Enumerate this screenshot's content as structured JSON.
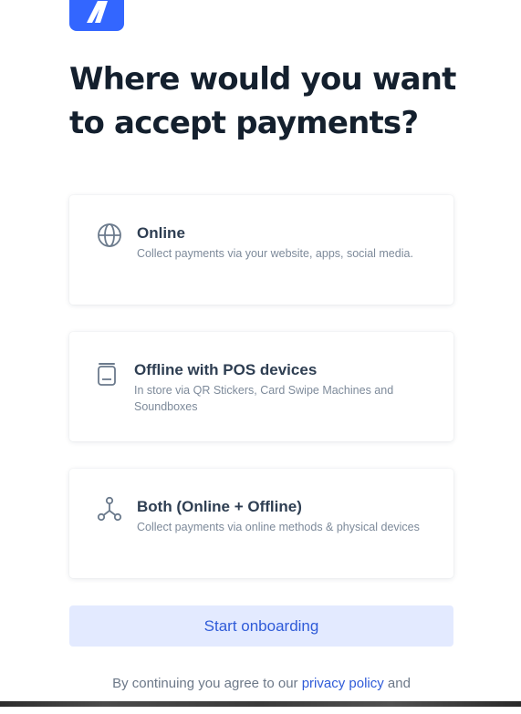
{
  "brand": {
    "logo_icon": "razorpay-logo-icon",
    "accent_color": "#3366ff"
  },
  "heading": {
    "title": "Where would you want to accept payments?"
  },
  "options": [
    {
      "title": "Online",
      "description": "Collect payments via your website, apps, social media.",
      "icon": "globe-icon"
    },
    {
      "title": "Offline with POS devices",
      "description": "In store via QR Stickers, Card Swipe Machines and Soundboxes",
      "icon": "pos-device-icon"
    },
    {
      "title": "Both (Online + Offline)",
      "description": "Collect payments via online methods & physical devices",
      "icon": "network-icon"
    }
  ],
  "cta": {
    "label": "Start onboarding",
    "background": "#e3eaff",
    "text_color": "#2f5bd8"
  },
  "footer": {
    "prefix": "By continuing you agree to our ",
    "privacy_link": "privacy policy",
    "suffix": " and"
  }
}
